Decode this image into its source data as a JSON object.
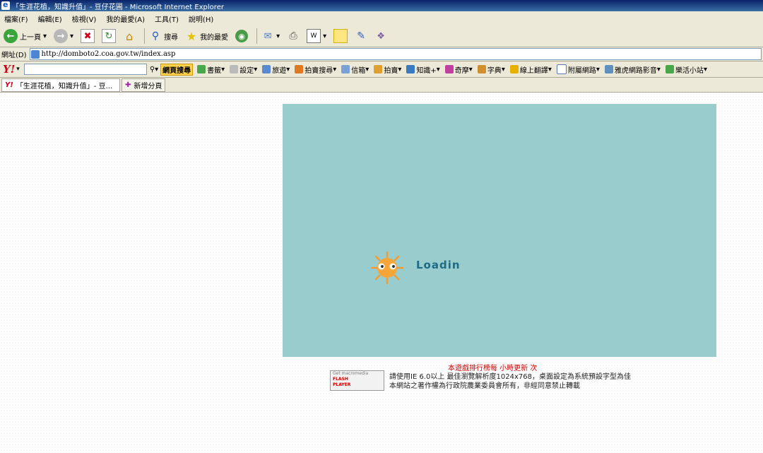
{
  "window": {
    "title": "「生涯花植，知識升值」- 豆仔花圃 - Microsoft Internet Explorer"
  },
  "menu": [
    "檔案(F)",
    "編輯(E)",
    "檢視(V)",
    "我的最愛(A)",
    "工具(T)",
    "說明(H)"
  ],
  "toolbar": {
    "back_label": "上一頁",
    "search_label": "搜尋",
    "favorites_label": "我的最愛"
  },
  "address": {
    "label": "網址(D)",
    "url": "http://domboto2.coa.gov.tw/index.asp"
  },
  "yahoo": {
    "logo": "Y!",
    "search_button": "網頁搜尋",
    "items": [
      "書籤",
      "設定",
      "旅遊",
      "拍賣搜尋",
      "信箱",
      "拍賣",
      "知識+",
      "奇摩",
      "字典",
      "線上翻譯",
      "附屬網路",
      "雅虎網路影音",
      "樂活小站"
    ]
  },
  "tabs": [
    {
      "label": "「生涯花植，知識升值」- 豆...",
      "active": true
    },
    {
      "label": "新增分頁",
      "active": false
    }
  ],
  "content": {
    "loading_text": "Loadin",
    "notice": "本遊戲排行榜每 小時更新 次",
    "flash_badge": {
      "line1": "Get macromedia",
      "line2": "FLASH",
      "line3": "PLAYER"
    },
    "footer_line1": "請使用IE 6.0以上 最佳瀏覽解析度1024x768，桌面設定為系統預設字型為佳",
    "footer_line2": "本網站之著作權為行政院農業委員會所有，非經同意禁止轉載"
  }
}
